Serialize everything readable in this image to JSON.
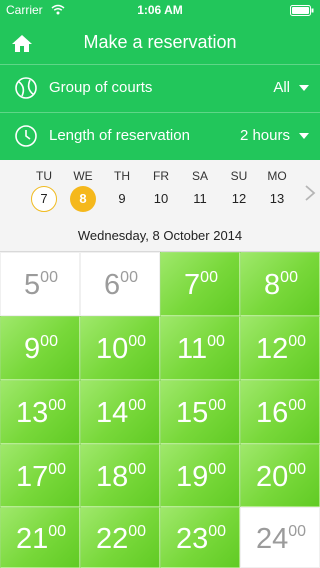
{
  "status_bar": {
    "carrier": "Carrier",
    "time": "1:06 AM"
  },
  "header": {
    "title": "Make a reservation",
    "courts": {
      "label": "Group of courts",
      "value": "All"
    },
    "length": {
      "label": "Length of reservation",
      "value": "2 hours"
    }
  },
  "calendar": {
    "days": [
      {
        "name": "TU",
        "num": "7",
        "state": "today"
      },
      {
        "name": "WE",
        "num": "8",
        "state": "selected"
      },
      {
        "name": "TH",
        "num": "9",
        "state": ""
      },
      {
        "name": "FR",
        "num": "10",
        "state": ""
      },
      {
        "name": "SA",
        "num": "11",
        "state": ""
      },
      {
        "name": "SU",
        "num": "12",
        "state": ""
      },
      {
        "name": "MO",
        "num": "13",
        "state": ""
      }
    ],
    "selected_date": "Wednesday, 8 October 2014"
  },
  "slots": [
    {
      "hour": "5",
      "minutes": "00",
      "available": false
    },
    {
      "hour": "6",
      "minutes": "00",
      "available": false
    },
    {
      "hour": "7",
      "minutes": "00",
      "available": true
    },
    {
      "hour": "8",
      "minutes": "00",
      "available": true
    },
    {
      "hour": "9",
      "minutes": "00",
      "available": true
    },
    {
      "hour": "10",
      "minutes": "00",
      "available": true
    },
    {
      "hour": "11",
      "minutes": "00",
      "available": true
    },
    {
      "hour": "12",
      "minutes": "00",
      "available": true
    },
    {
      "hour": "13",
      "minutes": "00",
      "available": true
    },
    {
      "hour": "14",
      "minutes": "00",
      "available": true
    },
    {
      "hour": "15",
      "minutes": "00",
      "available": true
    },
    {
      "hour": "16",
      "minutes": "00",
      "available": true
    },
    {
      "hour": "17",
      "minutes": "00",
      "available": true
    },
    {
      "hour": "18",
      "minutes": "00",
      "available": true
    },
    {
      "hour": "19",
      "minutes": "00",
      "available": true
    },
    {
      "hour": "20",
      "minutes": "00",
      "available": true
    },
    {
      "hour": "21",
      "minutes": "00",
      "available": true
    },
    {
      "hour": "22",
      "minutes": "00",
      "available": true
    },
    {
      "hour": "23",
      "minutes": "00",
      "available": true
    },
    {
      "hour": "24",
      "minutes": "00",
      "available": false
    }
  ],
  "colors": {
    "header_green": "#22c65b",
    "slot_green": "#78d83a",
    "selected_day": "#f5b81c"
  },
  "icons": {
    "home": "home-icon",
    "courts": "tennis-ball-icon",
    "length": "clock-icon",
    "dropdown": "triangle-down-icon",
    "next": "chevron-right-icon"
  }
}
